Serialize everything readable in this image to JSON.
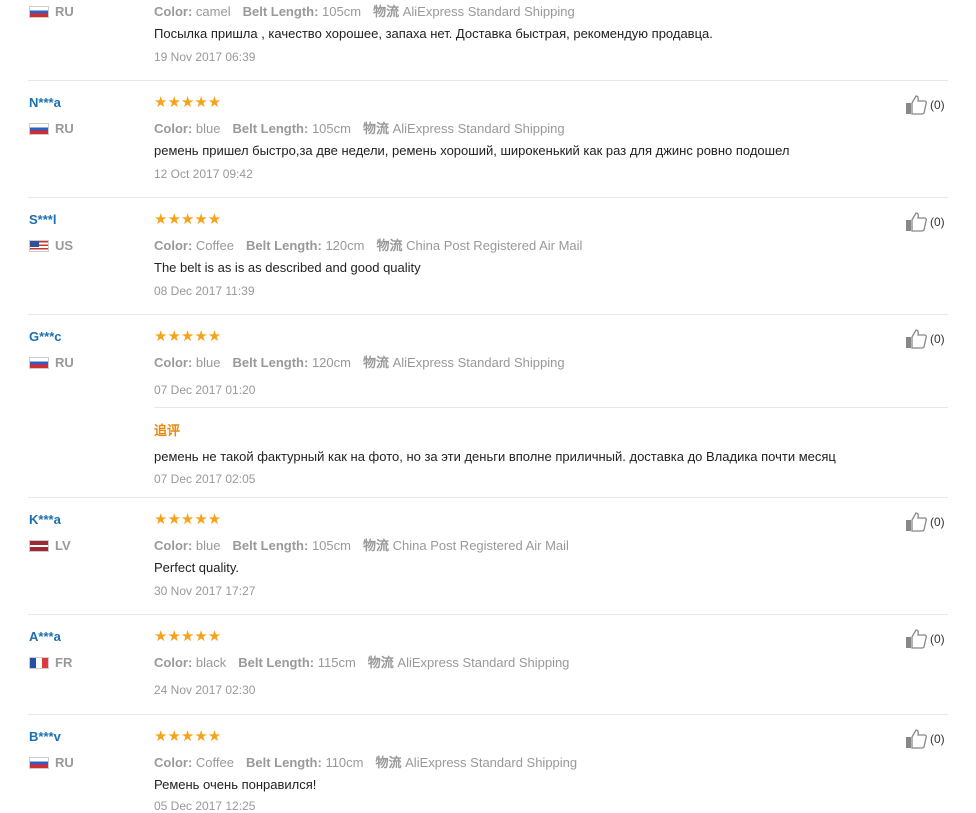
{
  "labels": {
    "color": "Color:",
    "belt_length": "Belt Length:",
    "shipping": "物流",
    "followup": "追评"
  },
  "star_icon": "star-icon",
  "thumb_icon": "thumbs-up-icon",
  "colors": {
    "username": "#1a6fb0",
    "star": "#f7a21b",
    "followup": "#e8880b"
  },
  "reviews": [
    {
      "user": "",
      "country": "RU",
      "flag": "ru",
      "stars": "",
      "color": "camel",
      "belt": "105cm",
      "shipping": "AliExpress Standard Shipping",
      "text": "Посылка пришла , качество хорошее, запаха нет. Доставка быстрая, рекомендую продавца.",
      "date": "19 Nov 2017 06:39",
      "helpful": ""
    },
    {
      "user": "N***a",
      "country": "RU",
      "flag": "ru",
      "stars": "★★★★★",
      "color": "blue",
      "belt": "105cm",
      "shipping": "AliExpress Standard Shipping",
      "text": "ремень пришел быстро,за две недели, ремень хороший, широкенький как раз для джинс ровно подошел",
      "date": "12 Oct 2017 09:42",
      "helpful": "(0)"
    },
    {
      "user": "S***l",
      "country": "US",
      "flag": "us",
      "stars": "★★★★★",
      "color": "Coffee",
      "belt": "120cm",
      "shipping": "China Post Registered Air Mail",
      "text": "The belt is as is as described and good quality",
      "date": "08 Dec 2017 11:39",
      "helpful": "(0)"
    },
    {
      "user": "G***c",
      "country": "RU",
      "flag": "ru",
      "stars": "★★★★★",
      "color": "blue",
      "belt": "120cm",
      "shipping": "AliExpress Standard Shipping",
      "text": "",
      "date": "07 Dec 2017 01:20",
      "helpful": "(0)",
      "followup_text": "ремень не такой фактурный как на фото, но за эти деньги вполне приличный. доставка до Владика почти месяц",
      "followup_date": "07 Dec 2017 02:05"
    },
    {
      "user": "K***a",
      "country": "LV",
      "flag": "lv",
      "stars": "★★★★★",
      "color": "blue",
      "belt": "105cm",
      "shipping": "China Post Registered Air Mail",
      "text": "Perfect quality.",
      "date": "30 Nov 2017 17:27",
      "helpful": "(0)"
    },
    {
      "user": "A***a",
      "country": "FR",
      "flag": "fr",
      "stars": "★★★★★",
      "color": "black",
      "belt": "115cm",
      "shipping": "AliExpress Standard Shipping",
      "text": "",
      "date": "24 Nov 2017 02:30",
      "helpful": "(0)"
    },
    {
      "user": "B***v",
      "country": "RU",
      "flag": "ru",
      "stars": "★★★★★",
      "color": "Coffee",
      "belt": "110cm",
      "shipping": "AliExpress Standard Shipping",
      "text": "Ремень очень понравился!",
      "date": "05 Dec 2017 12:25",
      "helpful": "(0)"
    }
  ]
}
